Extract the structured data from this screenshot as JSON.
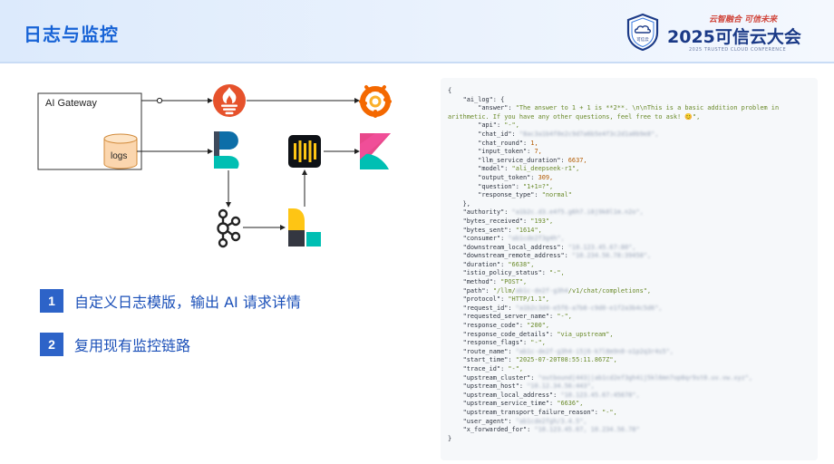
{
  "header": {
    "title": "日志与监控",
    "conference": {
      "slogan": "云智融合 可信未来",
      "name": "2025可信云大会",
      "subtitle": "2025 TRUSTED CLOUD CONFERENCE",
      "badge_text": "可信云"
    }
  },
  "diagram": {
    "gateway_label": "AI Gateway",
    "storage_label": "logs",
    "icons": [
      "prometheus-icon",
      "grafana-icon",
      "fluentbit-icon",
      "kibana-icon",
      "kafka-icon",
      "logstash-icon",
      "ilogtail-icon"
    ]
  },
  "points": [
    {
      "num": "1",
      "text": "自定义日志模版，输出 AI 请求详情"
    },
    {
      "num": "2",
      "text": "复用现有监控链路"
    }
  ],
  "colors": {
    "accent": "#2d63c8",
    "title": "#1763d6",
    "prometheus": "#e6522c",
    "grafana": "#f46800",
    "elastic_teal": "#00bfb3",
    "logstash_yellow": "#fec514"
  },
  "log": {
    "open": "{",
    "ai_log_open": "\"ai_log\": {",
    "answer_key": "\"answer\": ",
    "answer_value": "\"The answer to 1 + 1 is **2**. \\n\\nThis is a basic addition problem in",
    "answer_value_2": "arithmetic. If you have any other questions, feel free to ask! 😊\",",
    "api_key": "\"api\": ",
    "api_value": "\"-\",",
    "chat_id_key": "\"chat_id\": ",
    "chat_id_value": "\"8ac3a1b4f0e2c9d7a6b5e4f3c2d1a0b9e8\",",
    "chat_round_key": "\"chat_round\": ",
    "chat_round_value": "1,",
    "input_token_key": "\"input_token\": ",
    "input_token_value": "7,",
    "llm_duration_key": "\"llm_service_duration\": ",
    "llm_duration_value": "6637,",
    "model_key": "\"model\": ",
    "model_value": "\"ali_deepseek-r1\",",
    "output_token_key": "\"output_token\": ",
    "output_token_value": "309,",
    "question_key": "\"question\": ",
    "question_value": "\"1+1=?\",",
    "response_type_key": "\"response_type\": ",
    "response_type_value": "\"normal\"",
    "ai_log_close": "},",
    "authority_key": "\"authority\": ",
    "authority_value": "\"a1b2c.d3.e4f5.g6h7.i8j9k0l1m.n2o\",",
    "bytes_received_key": "\"bytes_received\": ",
    "bytes_received_value": "\"193\",",
    "bytes_sent_key": "\"bytes_sent\": ",
    "bytes_sent_value": "\"1614\",",
    "consumer_key": "\"consumer\": ",
    "consumer_value": "\"ab1cde2f3g4h\",",
    "downstream_local_key": "\"downstream_local_address\": ",
    "downstream_local_value": "\"10.123.45.67:80\",",
    "downstream_remote_key": "\"downstream_remote_address\": ",
    "downstream_remote_value": "\"10.234.56.78:39458\",",
    "duration_key": "\"duration\": ",
    "duration_value": "\"6638\",",
    "istio_key": "\"istio_policy_status\": ",
    "istio_value": "\"-\",",
    "method_key": "\"method\": ",
    "method_value": "\"POST\",",
    "path_key": "\"path\": ",
    "path_value": "\"/llm/",
    "path_blur": "ab1c-de2f-g3h4",
    "path_tail": "/v1/chat/completions\",",
    "protocol_key": "\"protocol\": ",
    "protocol_value": "\"HTTP/1.1\",",
    "request_id_key": "\"request_id\": ",
    "request_id_value": "\"a1b2c3d4-e5f6-a7b8-c9d0-e1f2a3b4c5d6\",",
    "requested_server_key": "\"requested_server_name\": ",
    "requested_server_value": "\"-\",",
    "response_code_key": "\"response_code\": ",
    "response_code_value": "\"200\",",
    "response_details_key": "\"response_code_details\": ",
    "response_details_value": "\"via_upstream\",",
    "response_flags_key": "\"response_flags\": ",
    "response_flags_value": "\"-\",",
    "route_name_key": "\"route_name\": ",
    "route_name_value": "\"ab1c-de2f-g3h4-i5j6-k7l8m9n0-o1p2q3r4s5\",",
    "start_time_key": "\"start_time\": ",
    "start_time_value": "\"2025-07-20T08:55:11.867Z\",",
    "trace_id_key": "\"trace_id\": ",
    "trace_id_value": "\"-\",",
    "upstream_cluster_key": "\"upstream_cluster\": ",
    "upstream_cluster_value": "\"outbound|443||ab1cd2ef3gh4ij5kl6mn7op8qr9st0.uv.vw.xyz\",",
    "upstream_host_key": "\"upstream_host\": ",
    "upstream_host_value": "\"10.12.34.56:443\",",
    "upstream_local_key": "\"upstream_local_address\": ",
    "upstream_local_value": "\"10.123.45.67:45678\",",
    "upstream_service_time_key": "\"upstream_service_time\": ",
    "upstream_service_time_value": "\"6636\",",
    "upstream_failure_key": "\"upstream_transport_failure_reason\": ",
    "upstream_failure_value": "\"-\",",
    "user_agent_key": "\"user_agent\": ",
    "user_agent_value": "\"ab1cde2fgh/3.4.5\",",
    "xff_key": "\"x_forwarded_for\": ",
    "xff_value": "\"10.123.45.67, 10.234.56.78\"",
    "close": "}"
  }
}
